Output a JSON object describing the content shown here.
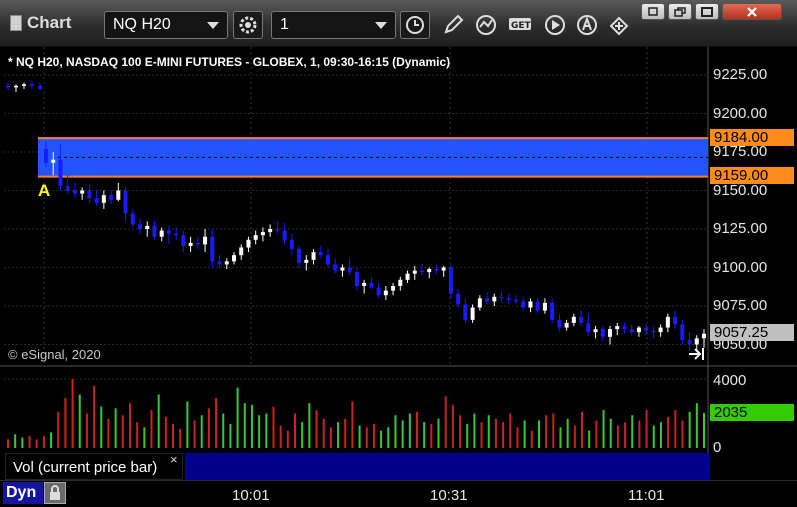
{
  "toolbar": {
    "app_title": "Chart",
    "symbol": "NQ H20",
    "interval": "1",
    "icons": [
      "gear-icon",
      "clock-icon",
      "pencil-icon",
      "study-icon",
      "get-icon",
      "play-icon",
      "auto-icon",
      "link-icon"
    ]
  },
  "window_buttons": [
    "restore-down-icon",
    "restore-icon",
    "maximize-icon",
    "close-icon"
  ],
  "chart": {
    "title": "* NQ H20, NASDAQ 100 E-MINI FUTURES - GLOBEX, 1, 09:30-16:15 (Dynamic)",
    "copyright": "© eSignal, 2020",
    "zone_label": "A",
    "zone_high": "9184.00",
    "zone_low": "9159.00",
    "last_price": "9057.25",
    "price_axis": [
      "9225.00",
      "9200.00",
      "9175.00",
      "9150.00",
      "9125.00",
      "9100.00",
      "9075.00",
      "9050.00"
    ],
    "volume_axis": [
      "4000",
      "0"
    ],
    "current_volume": "2035",
    "volume_legend": "Vol (current price bar)",
    "volume_legend_close": "×",
    "time_axis": [
      "10:01",
      "10:31",
      "11:01"
    ],
    "dyn_label": "Dyn",
    "colors": {
      "up": "#ffffff",
      "down": "#1a1aff",
      "zone": "#2255ff",
      "zone_border": "#ff7f27",
      "volume_up": "#33cc33",
      "volume_down": "#cc2222",
      "current_volume_bg": "#33cc00",
      "last_price_bg": "#c0c0c0"
    }
  },
  "chart_data": {
    "type": "candlestick",
    "price_range": [
      9040,
      9235
    ],
    "volume_range": [
      0,
      4500
    ],
    "candles": [
      [
        9218,
        9220,
        9215,
        9217
      ],
      [
        9217,
        9219,
        9214,
        9218
      ],
      [
        9218,
        9220,
        9216,
        9219
      ],
      [
        9219,
        9221,
        9216,
        9218
      ],
      [
        9218,
        9220,
        9215,
        9216
      ],
      [
        9177,
        9182,
        9165,
        9168
      ],
      [
        9168,
        9175,
        9160,
        9170
      ],
      [
        9170,
        9180,
        9150,
        9153
      ],
      [
        9153,
        9160,
        9148,
        9150
      ],
      [
        9150,
        9155,
        9145,
        9148
      ],
      [
        9148,
        9152,
        9144,
        9150
      ],
      [
        9150,
        9154,
        9142,
        9145
      ],
      [
        9145,
        9150,
        9140,
        9142
      ],
      [
        9142,
        9150,
        9138,
        9147
      ],
      [
        9147,
        9150,
        9141,
        9144
      ],
      [
        9144,
        9155,
        9143,
        9150
      ],
      [
        9150,
        9152,
        9130,
        9135
      ],
      [
        9135,
        9138,
        9126,
        9128
      ],
      [
        9128,
        9132,
        9122,
        9125
      ],
      [
        9125,
        9130,
        9120,
        9127
      ],
      [
        9127,
        9130,
        9118,
        9120
      ],
      [
        9120,
        9126,
        9117,
        9124
      ],
      [
        9124,
        9127,
        9115,
        9122
      ],
      [
        9122,
        9126,
        9118,
        9121
      ],
      [
        9121,
        9124,
        9110,
        9114
      ],
      [
        9114,
        9120,
        9110,
        9116
      ],
      [
        9116,
        9120,
        9112,
        9115
      ],
      [
        9115,
        9125,
        9110,
        9120
      ],
      [
        9120,
        9125,
        9100,
        9104
      ],
      [
        9104,
        9108,
        9100,
        9102
      ],
      [
        9102,
        9106,
        9099,
        9104
      ],
      [
        9104,
        9110,
        9102,
        9108
      ],
      [
        9108,
        9115,
        9105,
        9113
      ],
      [
        9113,
        9120,
        9110,
        9118
      ],
      [
        9118,
        9124,
        9115,
        9121
      ],
      [
        9121,
        9126,
        9117,
        9123
      ],
      [
        9123,
        9128,
        9120,
        9125
      ],
      [
        9125,
        9130,
        9122,
        9124
      ],
      [
        9124,
        9129,
        9115,
        9118
      ],
      [
        9118,
        9122,
        9108,
        9112
      ],
      [
        9112,
        9114,
        9100,
        9103
      ],
      [
        9103,
        9108,
        9098,
        9105
      ],
      [
        9105,
        9112,
        9102,
        9110
      ],
      [
        9110,
        9114,
        9106,
        9108
      ],
      [
        9108,
        9112,
        9100,
        9102
      ],
      [
        9102,
        9106,
        9096,
        9098
      ],
      [
        9098,
        9102,
        9094,
        9100
      ],
      [
        9100,
        9106,
        9095,
        9097
      ],
      [
        9097,
        9100,
        9085,
        9088
      ],
      [
        9088,
        9092,
        9083,
        9090
      ],
      [
        9090,
        9094,
        9086,
        9087
      ],
      [
        9087,
        9090,
        9080,
        9082
      ],
      [
        9082,
        9088,
        9079,
        9085
      ],
      [
        9085,
        9090,
        9082,
        9088
      ],
      [
        9088,
        9094,
        9085,
        9092
      ],
      [
        9092,
        9098,
        9090,
        9096
      ],
      [
        9096,
        9101,
        9092,
        9098
      ],
      [
        9098,
        9102,
        9095,
        9097
      ],
      [
        9097,
        9100,
        9093,
        9099
      ],
      [
        9099,
        9102,
        9096,
        9098
      ],
      [
        9098,
        9101,
        9094,
        9100
      ],
      [
        9100,
        9102,
        9080,
        9083
      ],
      [
        9083,
        9086,
        9074,
        9076
      ],
      [
        9076,
        9080,
        9064,
        9066
      ],
      [
        9066,
        9076,
        9064,
        9074
      ],
      [
        9074,
        9082,
        9072,
        9080
      ],
      [
        9080,
        9084,
        9076,
        9078
      ],
      [
        9078,
        9083,
        9075,
        9081
      ],
      [
        9081,
        9084,
        9077,
        9080
      ],
      [
        9080,
        9083,
        9076,
        9079
      ],
      [
        9079,
        9082,
        9076,
        9078
      ],
      [
        9078,
        9081,
        9072,
        9074
      ],
      [
        9074,
        9080,
        9071,
        9078
      ],
      [
        9078,
        9080,
        9070,
        9072
      ],
      [
        9072,
        9080,
        9070,
        9077
      ],
      [
        9077,
        9080,
        9064,
        9066
      ],
      [
        9066,
        9070,
        9058,
        9061
      ],
      [
        9061,
        9066,
        9059,
        9064
      ],
      [
        9064,
        9070,
        9062,
        9068
      ],
      [
        9068,
        9072,
        9062,
        9064
      ],
      [
        9064,
        9070,
        9056,
        9058
      ],
      [
        9058,
        9062,
        9054,
        9060
      ],
      [
        9060,
        9062,
        9052,
        9055
      ],
      [
        9055,
        9062,
        9050,
        9060
      ],
      [
        9060,
        9064,
        9056,
        9062
      ],
      [
        9062,
        9064,
        9057,
        9060
      ],
      [
        9060,
        9063,
        9056,
        9058
      ],
      [
        9058,
        9062,
        9055,
        9061
      ],
      [
        9061,
        9063,
        9056,
        9059
      ],
      [
        9059,
        9062,
        9054,
        9058
      ],
      [
        9058,
        9063,
        9055,
        9061
      ],
      [
        9061,
        9070,
        9058,
        9068
      ],
      [
        9068,
        9072,
        9060,
        9063
      ],
      [
        9063,
        9066,
        9050,
        9053
      ],
      [
        9053,
        9058,
        9046,
        9050
      ],
      [
        9050,
        9056,
        9046,
        9054
      ],
      [
        9054,
        9060,
        9048,
        9057
      ]
    ],
    "volume": [
      500,
      800,
      600,
      700,
      500,
      700,
      900,
      2100,
      2900,
      4000,
      3100,
      2000,
      3600,
      2400,
      1700,
      2300,
      1900,
      2600,
      1500,
      1200,
      2200,
      3100,
      1800,
      1400,
      1100,
      2700,
      1600,
      1900,
      2300,
      2900,
      2000,
      1400,
      3500,
      2600,
      2500,
      1900,
      2000,
      2400,
      1300,
      1000,
      2000,
      1500,
      2600,
      2200,
      1700,
      1200,
      1500,
      1700,
      2700,
      1300,
      1200,
      1400,
      1000,
      1200,
      1900,
      1600,
      2000,
      2100,
      1500,
      1400,
      1700,
      3000,
      2500,
      1900,
      1400,
      2000,
      1500,
      1900,
      1700,
      1500,
      2000,
      1200,
      1600,
      1000,
      1600,
      1900,
      2000,
      1200,
      1700,
      1300,
      2100,
      1000,
      1600,
      2200,
      1700,
      1300,
      1500,
      1900,
      1600,
      2200,
      1300,
      1500,
      1800,
      2200,
      1600,
      2100,
      2600,
      2035
    ]
  }
}
